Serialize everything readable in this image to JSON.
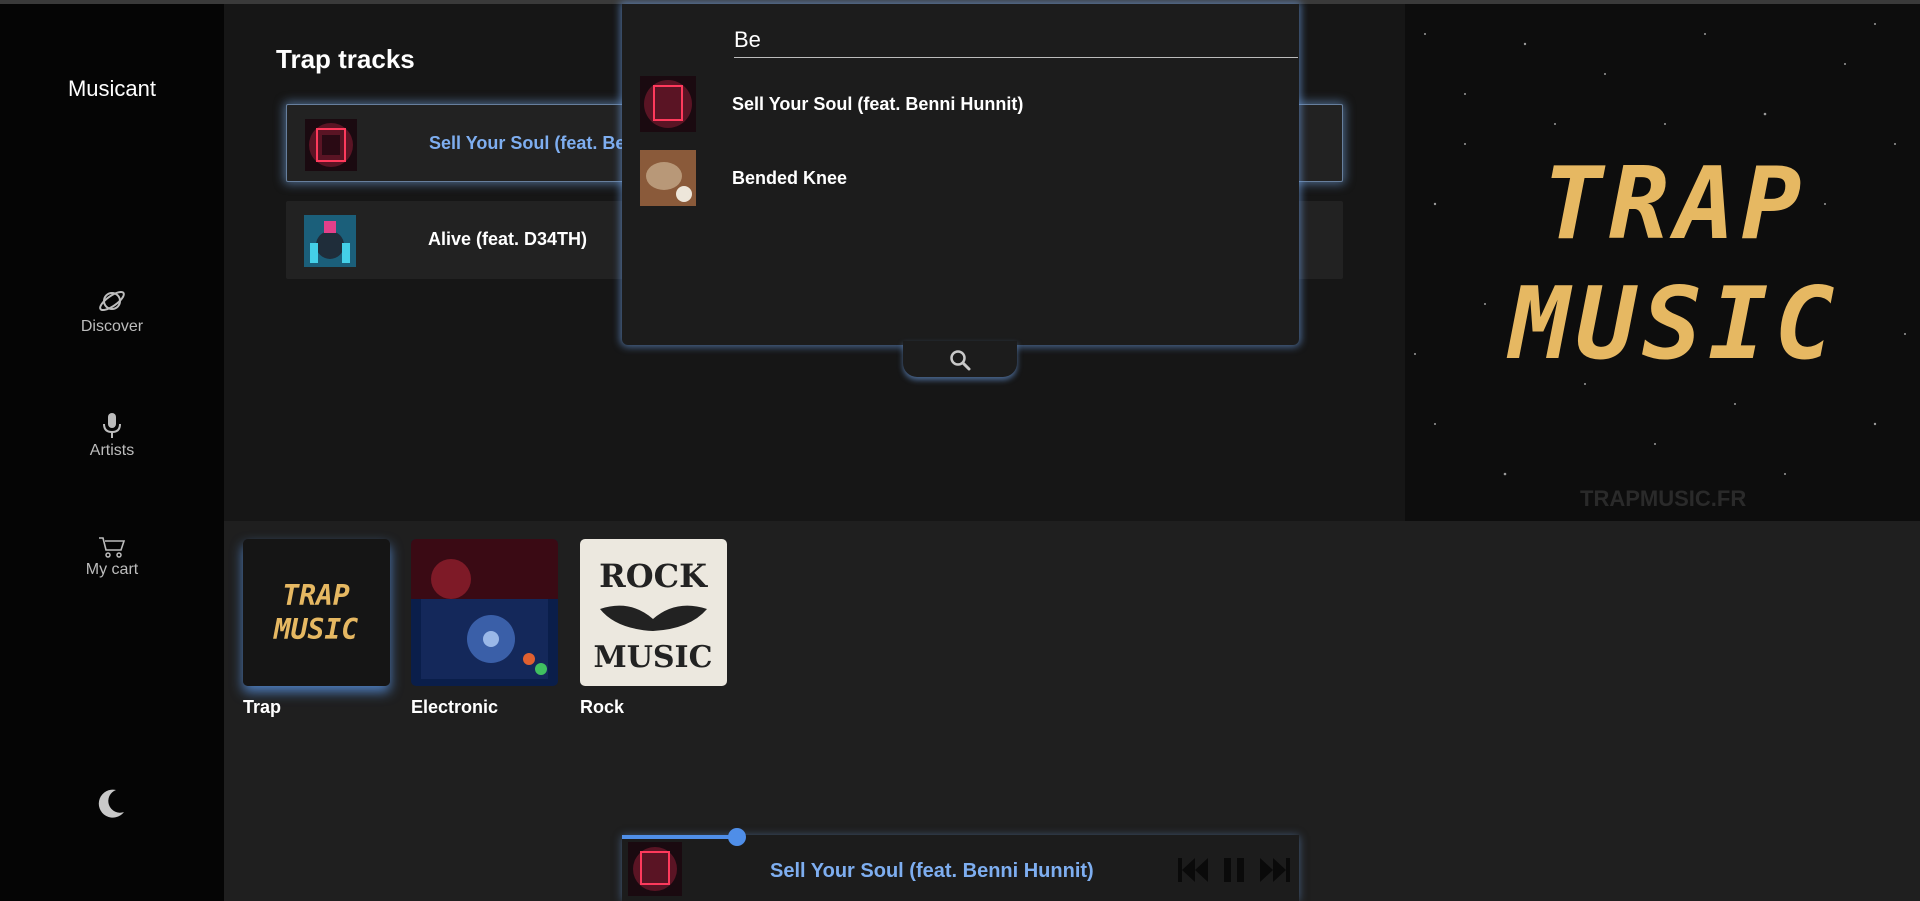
{
  "app": {
    "brand": "Musicant"
  },
  "sidebar": {
    "items": [
      {
        "label": "Discover",
        "icon": "planet-icon"
      },
      {
        "label": "Artists",
        "icon": "microphone-icon"
      },
      {
        "label": "My cart",
        "icon": "cart-icon"
      }
    ],
    "theme_toggle_icon": "moon-icon"
  },
  "main": {
    "section_title": "Trap tracks",
    "tracks": [
      {
        "title": "Sell Your Soul (feat. Benni Hunnit)",
        "active": true
      },
      {
        "title": "Alive (feat. D34TH)",
        "active": false
      }
    ]
  },
  "banner": {
    "line1": "TRAP",
    "line2": "MUSIC",
    "watermark": "TRAPMUSIC.FR"
  },
  "genres": [
    {
      "label": "Trap",
      "active": true,
      "art_text": "TRAP MUSIC"
    },
    {
      "label": "Electronic",
      "active": false
    },
    {
      "label": "Rock",
      "active": false,
      "art_text": "ROCK MUSIC"
    }
  ],
  "search": {
    "value": "Be",
    "results": [
      {
        "name": "Sell Your Soul (feat. Benni Hunnit)"
      },
      {
        "name": "Bended Knee"
      }
    ],
    "icon": "search-icon"
  },
  "player": {
    "title": "Sell Your Soul (feat. Benni Hunnit)",
    "progress": 0.17,
    "controls": [
      "skip-back-icon",
      "pause-icon",
      "skip-forward-icon"
    ]
  },
  "colors": {
    "accent": "#4f8ee8",
    "accent_text": "#7eaef0",
    "banner_gold": "#e6b862"
  }
}
